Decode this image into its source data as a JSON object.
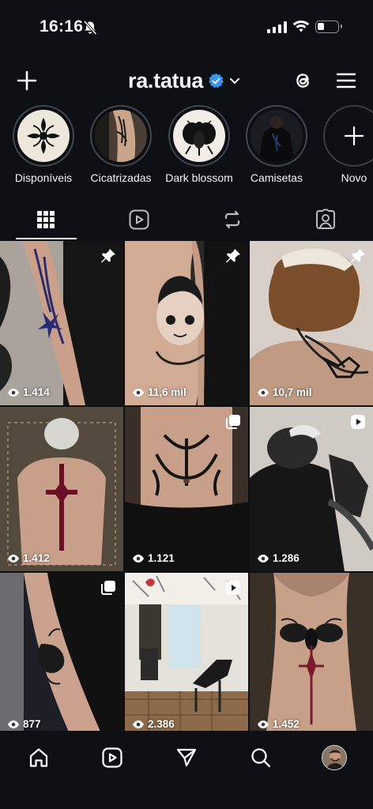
{
  "status_bar": {
    "time": "16:16"
  },
  "header": {
    "username": "ra.tatua"
  },
  "highlights": [
    {
      "label": "Disponíveis"
    },
    {
      "label": "Cicatrizadas"
    },
    {
      "label": "Dark blossom"
    },
    {
      "label": "Camisetas"
    },
    {
      "label": "Novo"
    }
  ],
  "tabs": [
    "posts-grid",
    "reels",
    "reposts",
    "tagged"
  ],
  "posts": [
    {
      "views": "1.414",
      "badge": "pin"
    },
    {
      "views": "11,6 mil",
      "badge": "pin"
    },
    {
      "views": "10,7 mil",
      "badge": "pin"
    },
    {
      "views": "1.412",
      "badge": ""
    },
    {
      "views": "1.121",
      "badge": "carousel"
    },
    {
      "views": "1.286",
      "badge": "reel"
    },
    {
      "views": "877",
      "badge": "carousel"
    },
    {
      "views": "2.386",
      "badge": "reel"
    },
    {
      "views": "1.452",
      "badge": ""
    }
  ],
  "nav": [
    "home",
    "reels",
    "messages",
    "search",
    "profile"
  ],
  "colors": {
    "background": "#0c1014",
    "verified": "#3897f0",
    "text": "#f5f5f5"
  }
}
